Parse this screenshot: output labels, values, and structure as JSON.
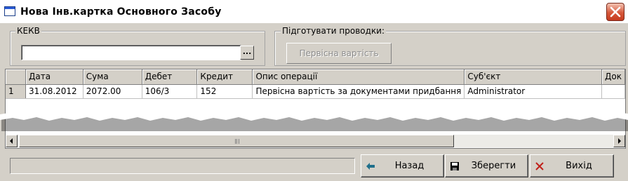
{
  "window": {
    "title": "Нова Інв.картка Основного Засобу",
    "icons": {
      "app": "window-icon",
      "close": "close-x-icon"
    }
  },
  "kekv_group": {
    "label": "КЕКВ",
    "input_value": "",
    "browse_label": "..."
  },
  "postings_group": {
    "label": "Підготувати проводки:",
    "initial_cost_label": "Первісна вартість"
  },
  "table": {
    "columns": [
      "",
      "Дата",
      "Сума",
      "Дебет",
      "Кредит",
      "Опис операції",
      "Суб'єкт",
      "Док"
    ],
    "rows": [
      [
        "1",
        "31.08.2012",
        "2072.00",
        "106/3",
        "152",
        "Первісна вартість за документами придбання",
        "Administrator",
        ""
      ]
    ]
  },
  "status_text": "",
  "buttons": {
    "back": {
      "label": "Назад",
      "icon": "arrow-left-icon"
    },
    "save": {
      "label": "Зберегти",
      "icon": "floppy-disk-icon"
    },
    "exit": {
      "label": "Вихід",
      "icon": "red-x-icon"
    }
  },
  "colors": {
    "face": "#d4d0c8",
    "close_button": "#d6573a",
    "exit_icon": "#c0201a",
    "back_icon": "#1f6f8b"
  }
}
